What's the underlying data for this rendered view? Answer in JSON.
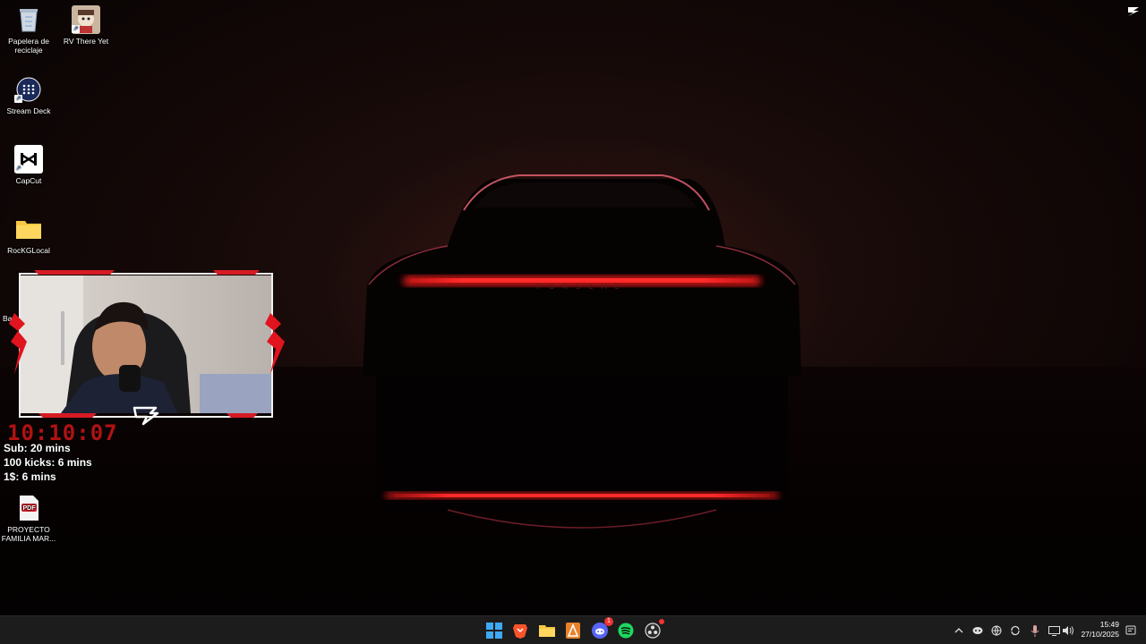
{
  "desktop": {
    "icons": [
      {
        "label": "Papelera de reciclaje",
        "icon": "recycle-bin-icon"
      },
      {
        "label": "RV There Yet",
        "icon": "game-icon"
      },
      {
        "label": "Stream Deck",
        "icon": "stream-deck-icon"
      },
      {
        "label": "CapCut",
        "icon": "capcut-icon"
      },
      {
        "label": "RocKGLocal",
        "icon": "folder-icon"
      },
      {
        "label": "Bac",
        "icon": "folder-icon"
      },
      {
        "label": "PROYECTO FAMILIA MAR...",
        "icon": "pdf-icon"
      }
    ],
    "pdf_badge": "PDF"
  },
  "overlay": {
    "timer": "10:10:07",
    "stats": [
      "Sub: 20 mins",
      "100 kicks: 6 mins",
      "1$: 6 mins"
    ]
  },
  "taskbar": {
    "apps": [
      "windows-start-icon",
      "brave-icon",
      "file-explorer-icon",
      "app-icon",
      "discord-icon",
      "spotify-icon",
      "obs-icon"
    ],
    "discord_badge": "1",
    "tray": [
      "chevron-up-icon",
      "discord-tray-icon",
      "network-globe-icon",
      "sync-icon",
      "microphone-icon",
      "display-icon",
      "volume-icon"
    ],
    "time": "15:49",
    "date": "27/10/2025"
  },
  "colors": {
    "accent_red": "#e0141e",
    "taskbar_bg": "#1c1c1c"
  }
}
